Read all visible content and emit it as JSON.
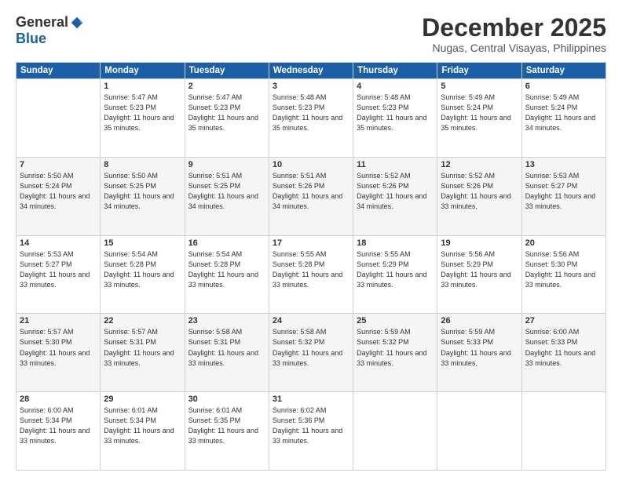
{
  "logo": {
    "general": "General",
    "blue": "Blue"
  },
  "title": "December 2025",
  "location": "Nugas, Central Visayas, Philippines",
  "days_header": [
    "Sunday",
    "Monday",
    "Tuesday",
    "Wednesday",
    "Thursday",
    "Friday",
    "Saturday"
  ],
  "weeks": [
    [
      {
        "day": "",
        "info": ""
      },
      {
        "day": "1",
        "info": "Sunrise: 5:47 AM\nSunset: 5:23 PM\nDaylight: 11 hours and 35 minutes."
      },
      {
        "day": "2",
        "info": "Sunrise: 5:47 AM\nSunset: 5:23 PM\nDaylight: 11 hours and 35 minutes."
      },
      {
        "day": "3",
        "info": "Sunrise: 5:48 AM\nSunset: 5:23 PM\nDaylight: 11 hours and 35 minutes."
      },
      {
        "day": "4",
        "info": "Sunrise: 5:48 AM\nSunset: 5:23 PM\nDaylight: 11 hours and 35 minutes."
      },
      {
        "day": "5",
        "info": "Sunrise: 5:49 AM\nSunset: 5:24 PM\nDaylight: 11 hours and 35 minutes."
      },
      {
        "day": "6",
        "info": "Sunrise: 5:49 AM\nSunset: 5:24 PM\nDaylight: 11 hours and 34 minutes."
      }
    ],
    [
      {
        "day": "7",
        "info": "Sunrise: 5:50 AM\nSunset: 5:24 PM\nDaylight: 11 hours and 34 minutes."
      },
      {
        "day": "8",
        "info": "Sunrise: 5:50 AM\nSunset: 5:25 PM\nDaylight: 11 hours and 34 minutes."
      },
      {
        "day": "9",
        "info": "Sunrise: 5:51 AM\nSunset: 5:25 PM\nDaylight: 11 hours and 34 minutes."
      },
      {
        "day": "10",
        "info": "Sunrise: 5:51 AM\nSunset: 5:26 PM\nDaylight: 11 hours and 34 minutes."
      },
      {
        "day": "11",
        "info": "Sunrise: 5:52 AM\nSunset: 5:26 PM\nDaylight: 11 hours and 34 minutes."
      },
      {
        "day": "12",
        "info": "Sunrise: 5:52 AM\nSunset: 5:26 PM\nDaylight: 11 hours and 33 minutes."
      },
      {
        "day": "13",
        "info": "Sunrise: 5:53 AM\nSunset: 5:27 PM\nDaylight: 11 hours and 33 minutes."
      }
    ],
    [
      {
        "day": "14",
        "info": "Sunrise: 5:53 AM\nSunset: 5:27 PM\nDaylight: 11 hours and 33 minutes."
      },
      {
        "day": "15",
        "info": "Sunrise: 5:54 AM\nSunset: 5:28 PM\nDaylight: 11 hours and 33 minutes."
      },
      {
        "day": "16",
        "info": "Sunrise: 5:54 AM\nSunset: 5:28 PM\nDaylight: 11 hours and 33 minutes."
      },
      {
        "day": "17",
        "info": "Sunrise: 5:55 AM\nSunset: 5:28 PM\nDaylight: 11 hours and 33 minutes."
      },
      {
        "day": "18",
        "info": "Sunrise: 5:55 AM\nSunset: 5:29 PM\nDaylight: 11 hours and 33 minutes."
      },
      {
        "day": "19",
        "info": "Sunrise: 5:56 AM\nSunset: 5:29 PM\nDaylight: 11 hours and 33 minutes."
      },
      {
        "day": "20",
        "info": "Sunrise: 5:56 AM\nSunset: 5:30 PM\nDaylight: 11 hours and 33 minutes."
      }
    ],
    [
      {
        "day": "21",
        "info": "Sunrise: 5:57 AM\nSunset: 5:30 PM\nDaylight: 11 hours and 33 minutes."
      },
      {
        "day": "22",
        "info": "Sunrise: 5:57 AM\nSunset: 5:31 PM\nDaylight: 11 hours and 33 minutes."
      },
      {
        "day": "23",
        "info": "Sunrise: 5:58 AM\nSunset: 5:31 PM\nDaylight: 11 hours and 33 minutes."
      },
      {
        "day": "24",
        "info": "Sunrise: 5:58 AM\nSunset: 5:32 PM\nDaylight: 11 hours and 33 minutes."
      },
      {
        "day": "25",
        "info": "Sunrise: 5:59 AM\nSunset: 5:32 PM\nDaylight: 11 hours and 33 minutes."
      },
      {
        "day": "26",
        "info": "Sunrise: 5:59 AM\nSunset: 5:33 PM\nDaylight: 11 hours and 33 minutes."
      },
      {
        "day": "27",
        "info": "Sunrise: 6:00 AM\nSunset: 5:33 PM\nDaylight: 11 hours and 33 minutes."
      }
    ],
    [
      {
        "day": "28",
        "info": "Sunrise: 6:00 AM\nSunset: 5:34 PM\nDaylight: 11 hours and 33 minutes."
      },
      {
        "day": "29",
        "info": "Sunrise: 6:01 AM\nSunset: 5:34 PM\nDaylight: 11 hours and 33 minutes."
      },
      {
        "day": "30",
        "info": "Sunrise: 6:01 AM\nSunset: 5:35 PM\nDaylight: 11 hours and 33 minutes."
      },
      {
        "day": "31",
        "info": "Sunrise: 6:02 AM\nSunset: 5:36 PM\nDaylight: 11 hours and 33 minutes."
      },
      {
        "day": "",
        "info": ""
      },
      {
        "day": "",
        "info": ""
      },
      {
        "day": "",
        "info": ""
      }
    ]
  ]
}
